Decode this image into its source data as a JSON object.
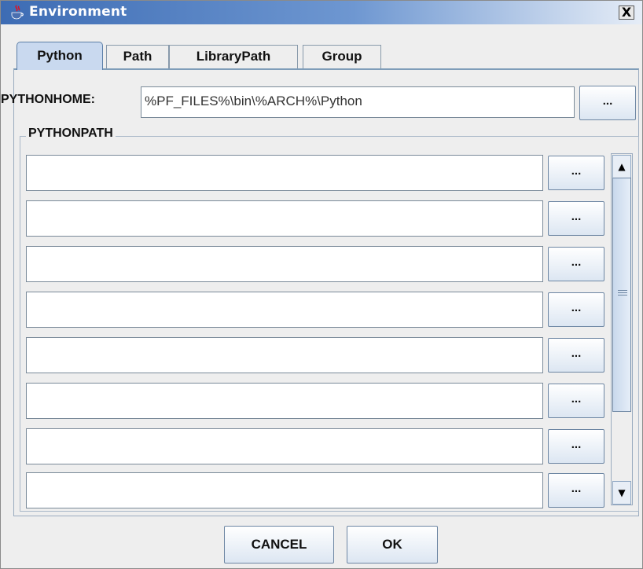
{
  "window": {
    "title": "Environment",
    "close_label": "X"
  },
  "tabs": [
    {
      "label": "Python",
      "active": true
    },
    {
      "label": "Path",
      "active": false
    },
    {
      "label": "LibraryPath",
      "active": false
    },
    {
      "label": "Group",
      "active": false
    }
  ],
  "python_home": {
    "label": "PYTHONHOME:",
    "value": "%PF_FILES%\\bin\\%ARCH%\\Python",
    "browse_label": "..."
  },
  "python_path": {
    "legend": "PYTHONPATH",
    "rows": [
      {
        "value": "",
        "browse_label": "..."
      },
      {
        "value": "",
        "browse_label": "..."
      },
      {
        "value": "",
        "browse_label": "..."
      },
      {
        "value": "",
        "browse_label": "..."
      },
      {
        "value": "",
        "browse_label": "..."
      },
      {
        "value": "",
        "browse_label": "..."
      },
      {
        "value": "",
        "browse_label": "..."
      },
      {
        "value": "",
        "browse_label": "..."
      }
    ]
  },
  "buttons": {
    "cancel": "CANCEL",
    "ok": "OK"
  },
  "colors": {
    "title_start": "#3d6cb4",
    "active_tab": "#c9d9ef",
    "button_edge": "#6d86a3"
  }
}
